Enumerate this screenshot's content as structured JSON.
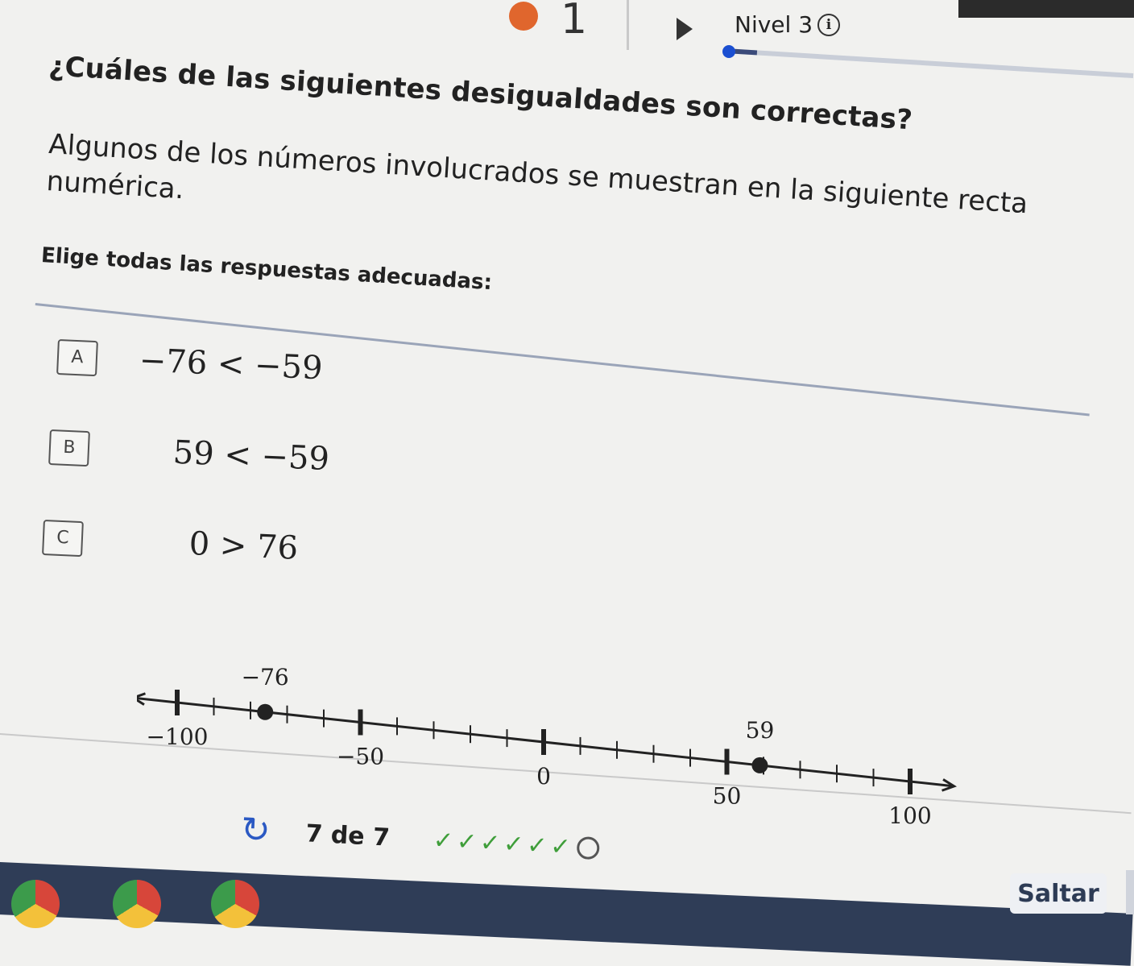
{
  "header": {
    "level_number": "1",
    "level_label": "Nivel 3",
    "info_icon": "ⓘ",
    "level_progress": 0.08
  },
  "question": {
    "title": "¿Cuáles de las siguientes desigualdades son correctas?",
    "instruction": "Algunos de los números involucrados se muestran en la siguiente recta numérica.",
    "choose_label": "Elige todas las respuestas adecuadas:"
  },
  "options": [
    {
      "letter": "A",
      "expression": "−76 < −59"
    },
    {
      "letter": "B",
      "expression": "59 < −59"
    },
    {
      "letter": "C",
      "expression": "0 > 76"
    }
  ],
  "number_line": {
    "min": -100,
    "max": 100,
    "tick_step": 10,
    "major_labels": [
      "−100",
      "−50",
      "0",
      "50",
      "100"
    ],
    "major_values": [
      -100,
      -50,
      0,
      50,
      100
    ],
    "points": [
      {
        "value": -76,
        "label": "−76"
      },
      {
        "value": 59,
        "label": "59"
      }
    ]
  },
  "progress": {
    "text": "7 de 7",
    "checks_done": 6,
    "check_symbol": "✓",
    "refresh_icon": "↻"
  },
  "footer": {
    "skip_label": "Saltar"
  },
  "colors": {
    "accent_blue": "#2b59c3",
    "level_orange": "#e0662d",
    "check_green": "#3f9e3a",
    "taskbar": "#2f3d57"
  }
}
